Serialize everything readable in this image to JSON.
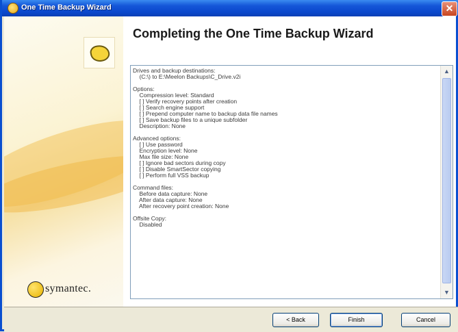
{
  "window": {
    "title": "One Time Backup Wizard",
    "close_glyph": "✕"
  },
  "brand": {
    "logo_text": "symantec."
  },
  "heading": "Completing the One Time Backup Wizard",
  "summary_lines": [
    "Drives and backup destinations:",
    "    (C:\\) to E:\\Meelon Backups\\C_Drive.v2i",
    "",
    "Options:",
    "    Compression level: Standard",
    "    [ ] Verify recovery points after creation",
    "    [ ] Search engine support",
    "    [ ] Prepend computer name to backup data file names",
    "    [ ] Save backup files to a unique subfolder",
    "    Description: None",
    "",
    "Advanced options:",
    "    [ ] Use password",
    "    Encryption level: None",
    "    Max file size: None",
    "    [ ] Ignore bad sectors during copy",
    "    [ ] Disable SmartSector copying",
    "    [ ] Perform full VSS backup",
    "",
    "Command files:",
    "    Before data capture: None",
    "    After data capture: None",
    "    After recovery point creation: None",
    "",
    "Offsite Copy:",
    "    Disabled"
  ],
  "buttons": {
    "back": "< Back",
    "finish": "Finish",
    "cancel": "Cancel"
  },
  "scroll": {
    "up_glyph": "▲",
    "down_glyph": "▼"
  },
  "icons": {
    "title": "wizard-app-icon",
    "badge": "backup-badge-icon",
    "logo": "symantec-logo-icon"
  }
}
